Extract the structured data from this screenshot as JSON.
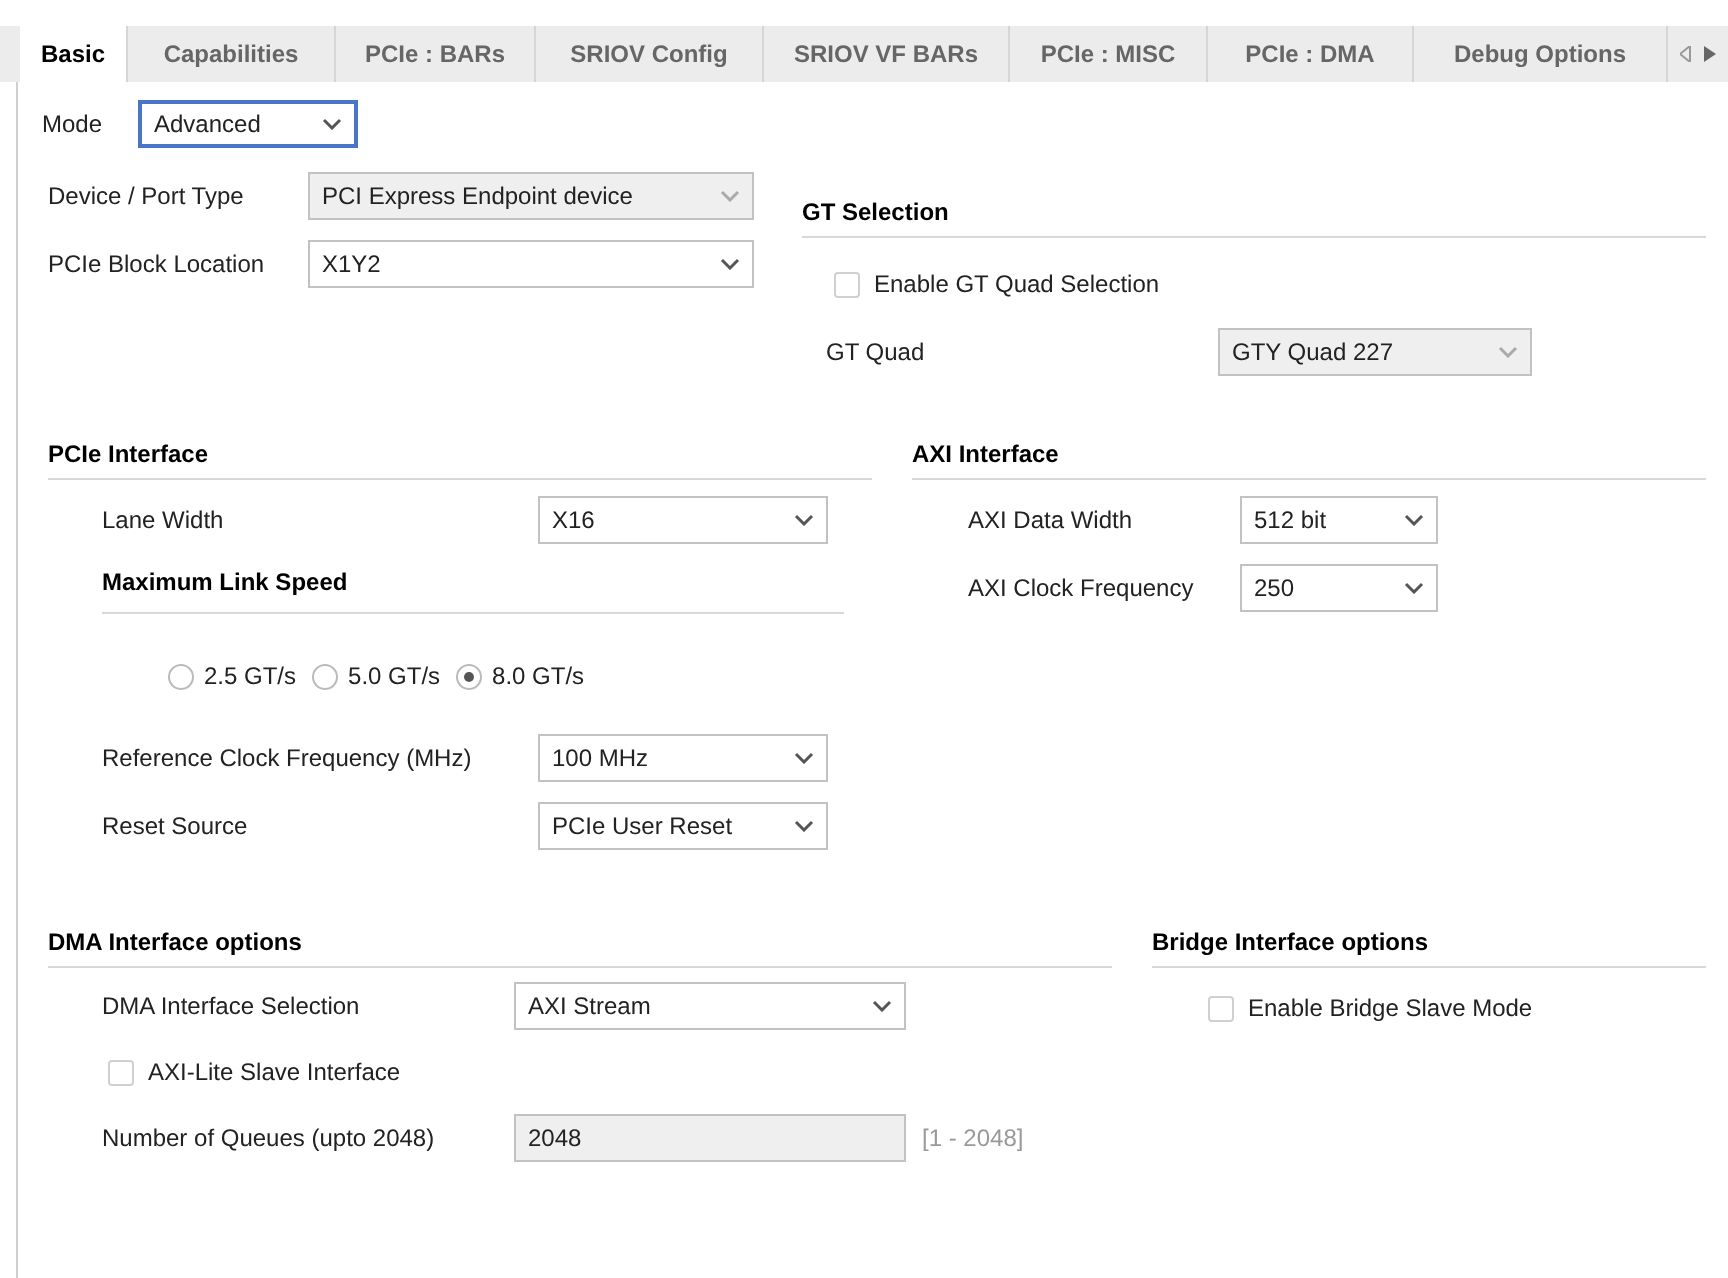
{
  "tabs": [
    {
      "label": "Basic",
      "selected": true
    },
    {
      "label": "Capabilities",
      "selected": false
    },
    {
      "label": "PCIe : BARs",
      "selected": false
    },
    {
      "label": "SRIOV Config",
      "selected": false
    },
    {
      "label": "SRIOV VF BARs",
      "selected": false
    },
    {
      "label": "PCIe : MISC",
      "selected": false
    },
    {
      "label": "PCIe : DMA",
      "selected": false
    },
    {
      "label": "Debug Options",
      "selected": false
    }
  ],
  "mode": {
    "label": "Mode",
    "value": "Advanced",
    "focused": true
  },
  "device_port_type": {
    "label": "Device / Port Type",
    "value": "PCI Express Endpoint device",
    "disabled": true
  },
  "pcie_block_location": {
    "label": "PCIe Block Location",
    "value": "X1Y2",
    "disabled": false
  },
  "gt_selection": {
    "title": "GT Selection",
    "enable_gt_quad_selection": {
      "label": "Enable GT Quad Selection",
      "checked": false
    },
    "gt_quad": {
      "label": "GT Quad",
      "value": "GTY Quad 227",
      "disabled": true
    }
  },
  "pcie_interface": {
    "title": "PCIe Interface",
    "lane_width": {
      "label": "Lane Width",
      "value": "X16",
      "disabled": false
    },
    "maximum_link_speed": {
      "title": "Maximum Link Speed",
      "options": [
        {
          "label": "2.5 GT/s",
          "selected": false
        },
        {
          "label": "5.0 GT/s",
          "selected": false
        },
        {
          "label": "8.0 GT/s",
          "selected": true
        }
      ]
    },
    "reference_clock_frequency": {
      "label": "Reference Clock Frequency (MHz)",
      "value": "100 MHz",
      "disabled": false
    },
    "reset_source": {
      "label": "Reset Source",
      "value": "PCIe User Reset",
      "disabled": false
    }
  },
  "axi_interface": {
    "title": "AXI Interface",
    "data_width": {
      "label": "AXI Data Width",
      "value": "512 bit",
      "disabled": false
    },
    "clock_frequency": {
      "label": "AXI Clock Frequency",
      "value": "250",
      "disabled": false
    }
  },
  "dma_interface_options": {
    "title": "DMA Interface options",
    "selection": {
      "label": "DMA Interface Selection",
      "value": "AXI Stream",
      "disabled": false
    },
    "axi_lite_slave_interface": {
      "label": "AXI-Lite Slave Interface",
      "checked": false
    },
    "number_of_queues": {
      "label": "Number of Queues (upto 2048)",
      "value": "2048",
      "disabled": true,
      "range": "[1 - 2048]"
    }
  },
  "bridge_interface_options": {
    "title": "Bridge Interface options",
    "enable_bridge_slave_mode": {
      "label": "Enable Bridge Slave Mode",
      "checked": false
    }
  }
}
